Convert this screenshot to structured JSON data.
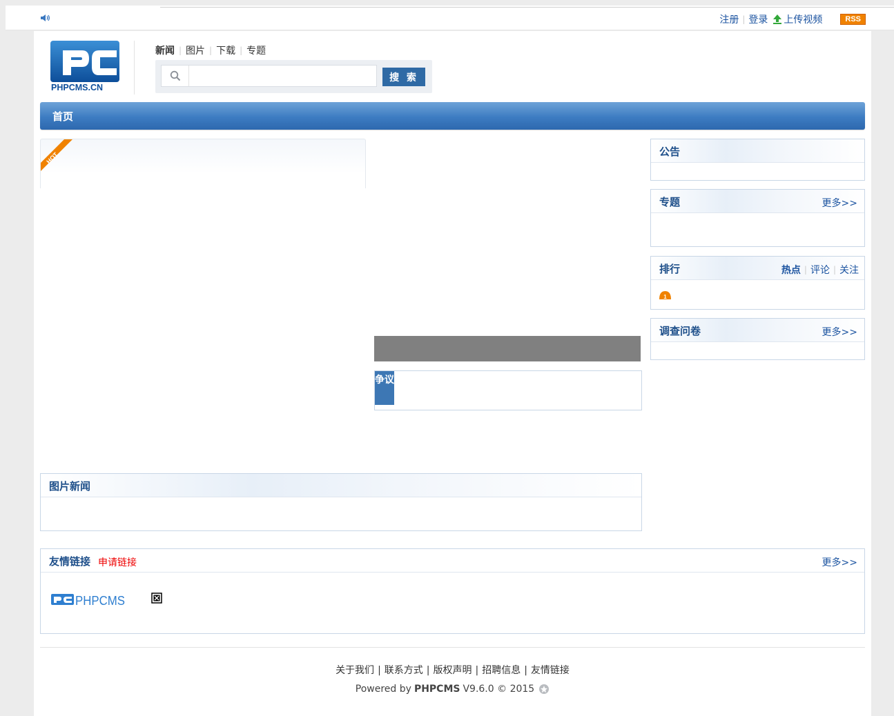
{
  "top_bar": {
    "register": "注册",
    "login": "登录",
    "upload_video": "上传视频",
    "rss": "RSS"
  },
  "header": {
    "logo_text": "PHPCMS.CN",
    "channels": [
      "新闻",
      "图片",
      "下载",
      "专题"
    ],
    "search": {
      "value": "",
      "placeholder": "",
      "button": "搜 索"
    }
  },
  "nav": {
    "home": "首页"
  },
  "focus": {
    "hot_label": "HOT"
  },
  "dispute": {
    "tag": "争议"
  },
  "sidebar": {
    "notice": {
      "title": "公告"
    },
    "special": {
      "title": "专题",
      "more": "更多>>"
    },
    "rank": {
      "title": "排行",
      "tabs": [
        "热点",
        "评论",
        "关注"
      ],
      "first_rank": "1"
    },
    "survey": {
      "title": "调查问卷",
      "more": "更多>>"
    }
  },
  "photo_news": {
    "title": "图片新闻"
  },
  "links": {
    "title": "友情链接",
    "apply": "申请链接",
    "more": "更多>>",
    "logo_text": "PHPCMS"
  },
  "footer": {
    "links": [
      "关于我们",
      "联系方式",
      "版权声明",
      "招聘信息",
      "友情链接"
    ],
    "separator": "|",
    "powered_prefix": "Powered by",
    "powered_brand": "PHPCMS",
    "powered_suffix": "V9.6.0 © 2015"
  },
  "colors": {
    "brand_blue": "#2f6aa5",
    "nav_blue": "#3d7cc2",
    "link_blue": "#1b53a0",
    "hot_orange": "#f08200",
    "apply_red": "#ee0000"
  }
}
